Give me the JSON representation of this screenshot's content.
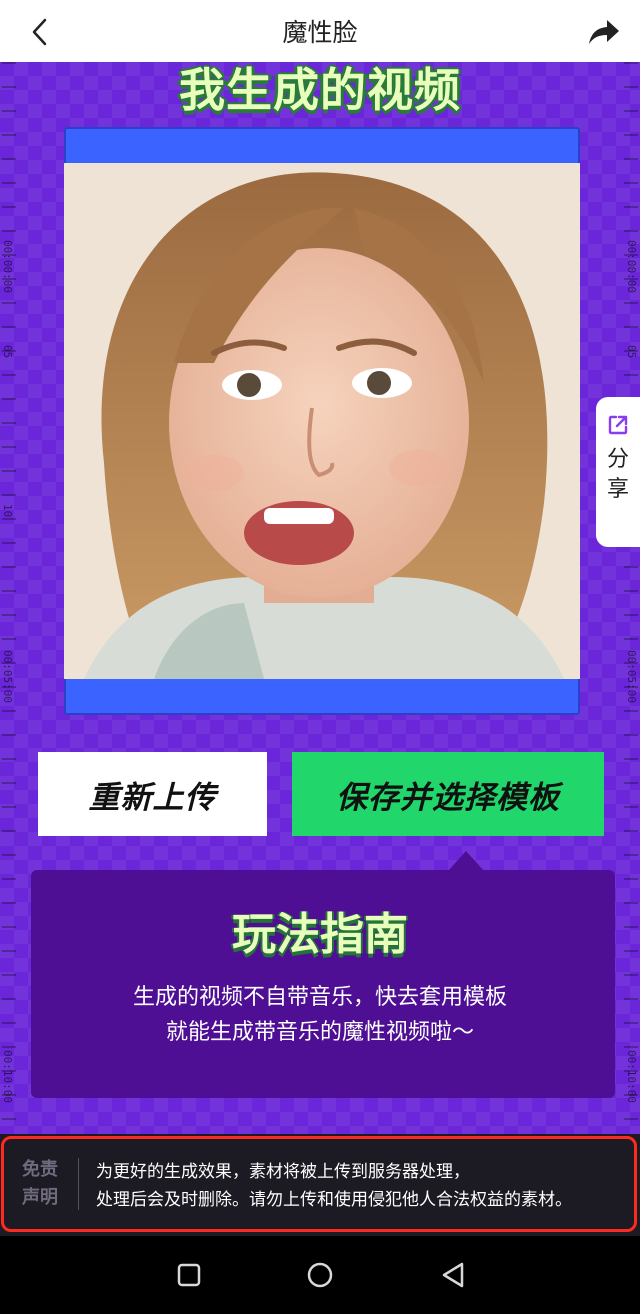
{
  "header": {
    "title": "魔性脸",
    "back_icon": "chevron-left-icon",
    "share_icon": "share-arrow-icon"
  },
  "main": {
    "heading": "我生成的视频",
    "ruler_labels": [
      "00:00:00",
      "05",
      "10",
      "00:05:00",
      "00:10:00"
    ],
    "video": {
      "subject": "generated face video"
    },
    "buttons": {
      "reupload": "重新上传",
      "save_and_choose": "保存并选择模板"
    },
    "guide": {
      "title": "玩法指南",
      "line1": "生成的视频不自带音乐，快去套用模板",
      "line2": "就能生成带音乐的魔性视频啦～"
    },
    "share_tab": {
      "icon": "external-link-icon",
      "char1": "分",
      "char2": "享"
    }
  },
  "disclaimer": {
    "label1": "免责",
    "label2": "声明",
    "line1": "为更好的生成效果，素材将被上传到服务器处理，",
    "line2": "处理后会及时删除。请勿上传和使用侵犯他人合法权益的素材。"
  },
  "colors": {
    "background_purple": "#6a26d8",
    "accent_green": "#21d66b",
    "video_frame_blue": "#3a63ff",
    "guide_box": "#4e0f95",
    "highlight_outline": "#ff2a1f"
  },
  "navbar": {
    "recents_icon": "square-icon",
    "home_icon": "circle-icon",
    "back_icon": "triangle-back-icon"
  }
}
